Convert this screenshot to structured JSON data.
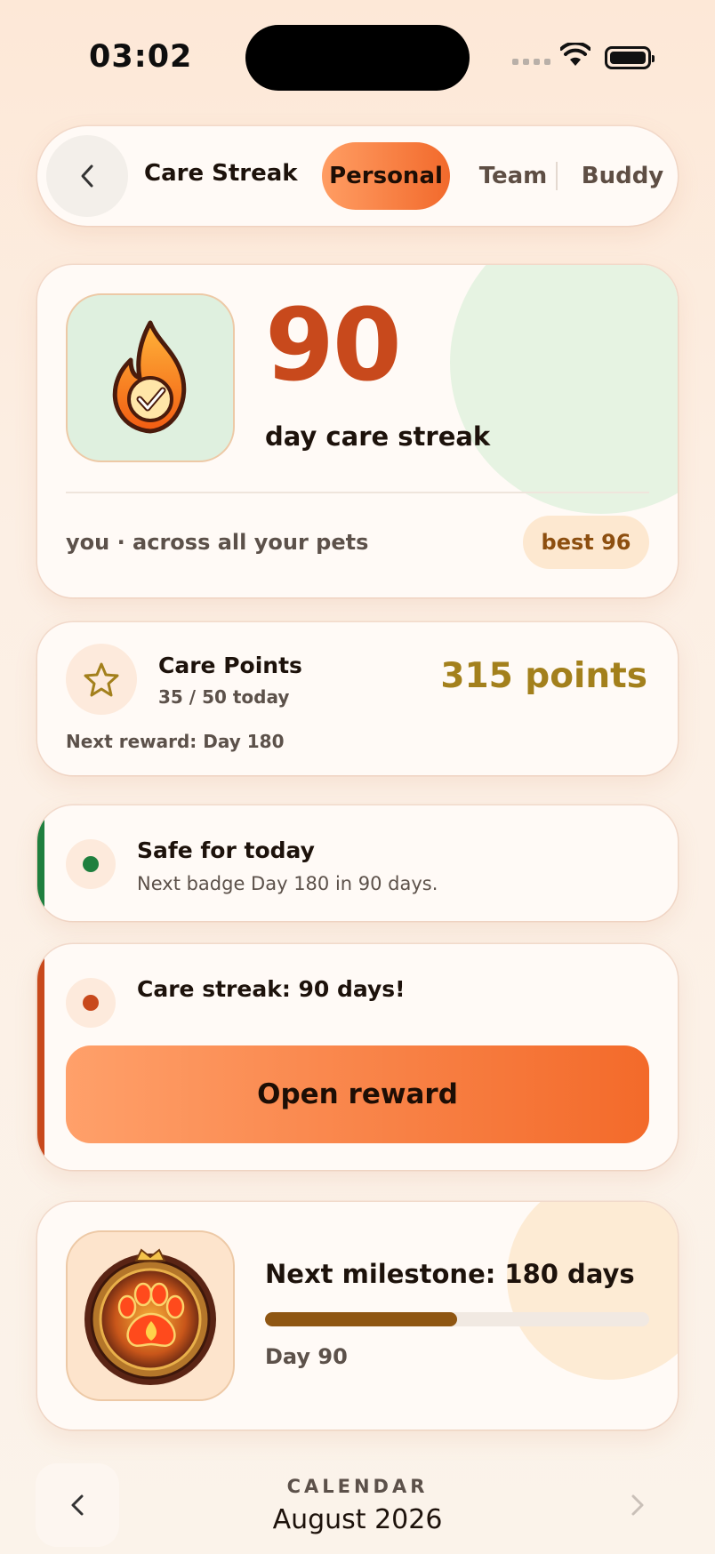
{
  "status_bar": {
    "time": "03:02"
  },
  "nav": {
    "title": "Care Streak",
    "tabs": [
      {
        "label": "Personal",
        "active": true
      },
      {
        "label": "Team",
        "active": false
      },
      {
        "label": "Buddy",
        "active": false
      }
    ],
    "icons": {
      "back": "chevron-left-icon"
    }
  },
  "streak": {
    "number": "90",
    "subtitle": "day care streak",
    "scope": "you · across all your pets",
    "best": "best 96",
    "icon": "flame-check-icon"
  },
  "points": {
    "title": "Care Points",
    "progress": "35 / 50 today",
    "value": "315 points",
    "next_reward": "Next reward: Day 180",
    "icon": "star-icon"
  },
  "alerts": {
    "safe": {
      "title": "Safe for today",
      "text": "Next badge Day 180 in 90 days.",
      "color": "#1f7f3e"
    },
    "streak": {
      "title": "Care streak: 90 days!",
      "button": "Open reward",
      "color": "#c8491c"
    }
  },
  "milestone": {
    "title": "Next milestone: 180 days",
    "progress_fraction": 0.5,
    "day_label": "Day 90",
    "icon": "paw-badge-icon"
  },
  "calendar": {
    "label": "CALENDAR",
    "month": "August 2026"
  },
  "colors": {
    "accent": "#f26a2c",
    "streak_number": "#c8491c",
    "points": "#a3801c",
    "safe": "#1f7f3e"
  }
}
